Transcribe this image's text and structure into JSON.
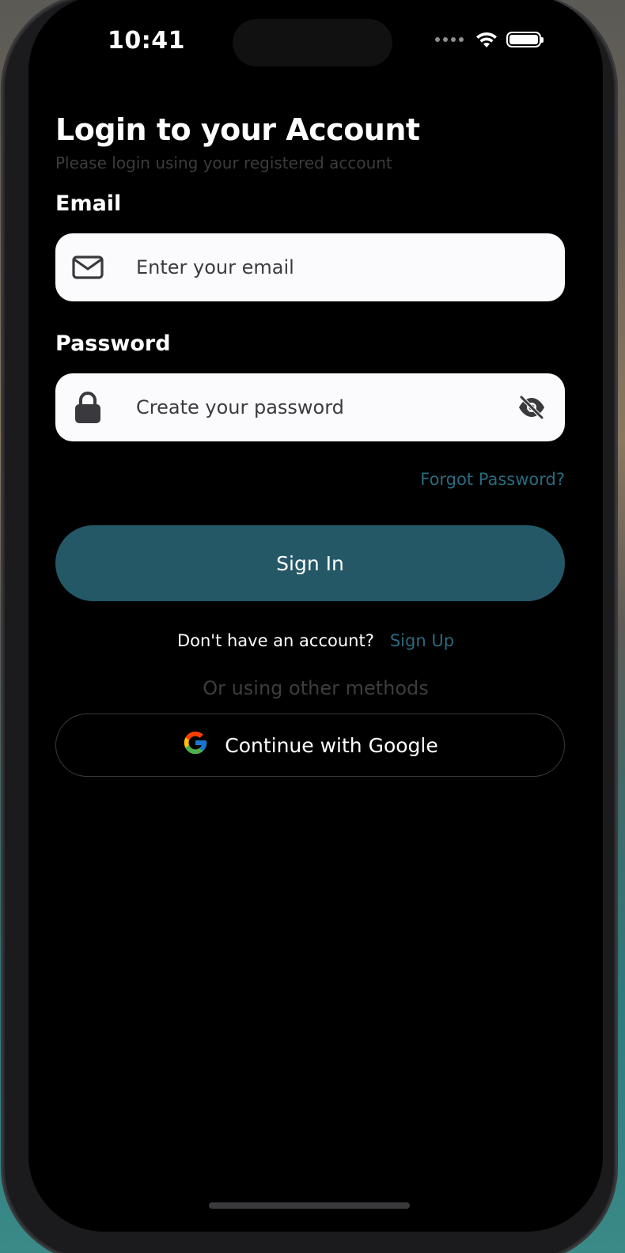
{
  "status_bar": {
    "time": "10:41"
  },
  "header": {
    "title": "Login to your Account",
    "subtitle": "Please login using your registered account"
  },
  "email": {
    "label": "Email",
    "placeholder": "Enter your email",
    "icon": "mail-icon"
  },
  "password": {
    "label": "Password",
    "placeholder": "Create your password",
    "icon": "lock-icon",
    "toggle_icon": "eye-off-icon"
  },
  "forgot_password": "Forgot Password?",
  "sign_in": "Sign In",
  "signup_prompt": {
    "question": "Don't have an account?",
    "link": "Sign Up"
  },
  "other_methods": "Or using other methods",
  "google": {
    "label": "Continue with Google",
    "icon": "google-logo-icon"
  },
  "colors": {
    "accent": "#245867",
    "link": "#2a6a7e",
    "background": "#000000",
    "field_bg": "#fbfbfd"
  }
}
